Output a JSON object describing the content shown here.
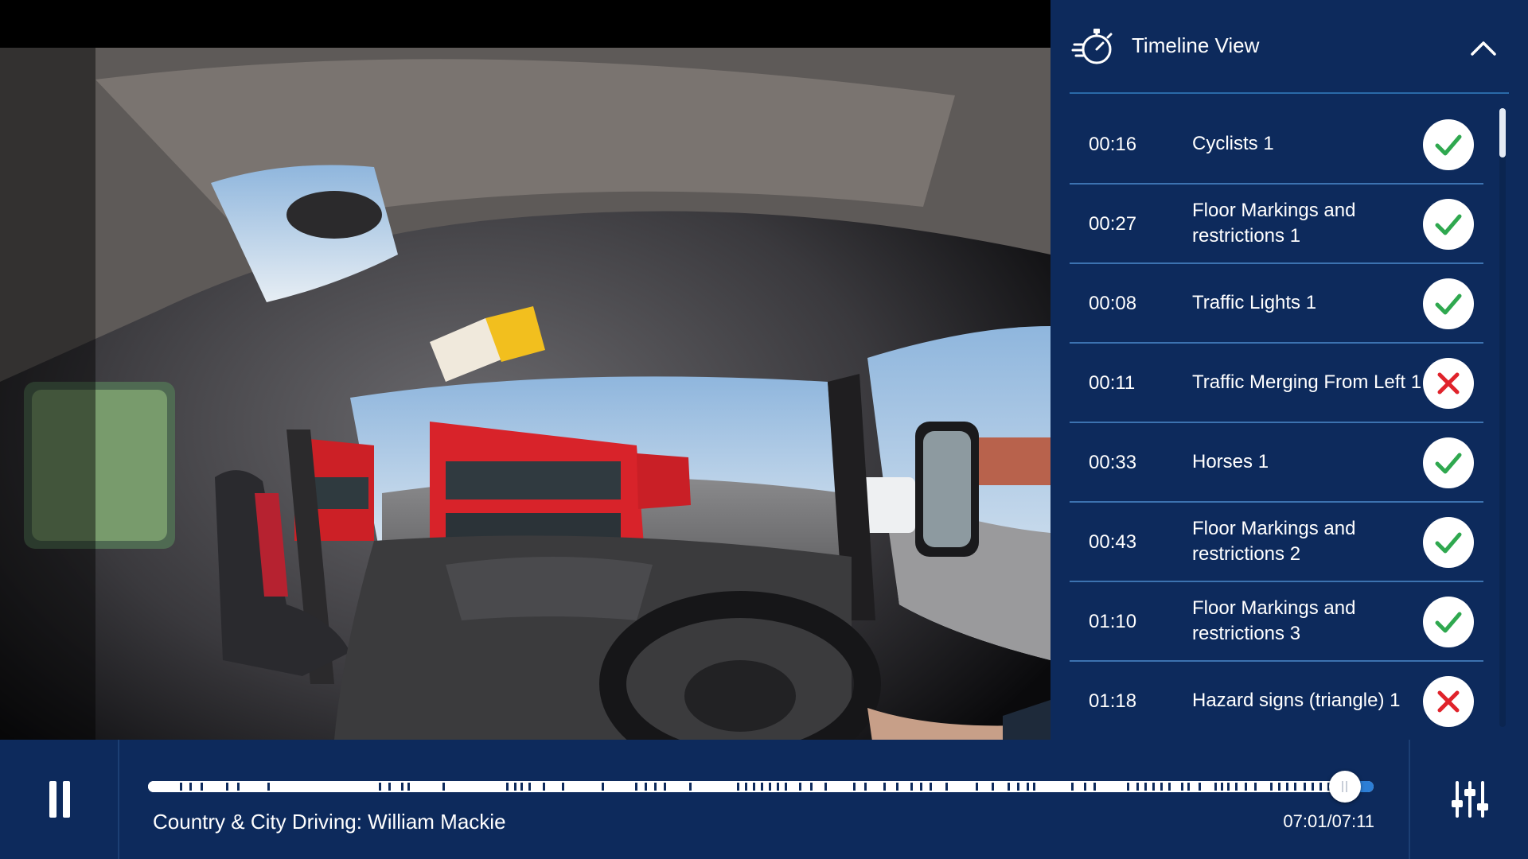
{
  "panel": {
    "title": "Timeline View",
    "icons": {
      "header": "stopwatch-icon",
      "collapse": "chevron-up-icon"
    },
    "items": [
      {
        "time": "00:16",
        "label": "Cyclists 1",
        "status": "correct"
      },
      {
        "time": "00:27",
        "label": "Floor Markings and restrictions 1",
        "status": "correct"
      },
      {
        "time": "00:08",
        "label": "Traffic Lights 1",
        "status": "correct"
      },
      {
        "time": "00:11",
        "label": "Traffic Merging From Left 1",
        "status": "incorrect"
      },
      {
        "time": "00:33",
        "label": "Horses 1",
        "status": "correct"
      },
      {
        "time": "00:43",
        "label": "Floor Markings and restrictions 2",
        "status": "correct"
      },
      {
        "time": "01:10",
        "label": "Floor Markings and restrictions 3",
        "status": "correct"
      },
      {
        "time": "01:18",
        "label": "Hazard signs (triangle) 1",
        "status": "incorrect"
      }
    ]
  },
  "player": {
    "video_title": "Country & City Driving: William Mackie",
    "time_display": "07:01/07:11",
    "progress": 0.9768,
    "state_icon": "pause-icon",
    "settings_icon": "sliders-icon"
  },
  "colors": {
    "panel_bg": "#0d2a5c",
    "divider": "#3c72b0",
    "correct": "#2fa84f",
    "incorrect": "#e0232b",
    "seek_remaining": "#2c7ed6"
  }
}
